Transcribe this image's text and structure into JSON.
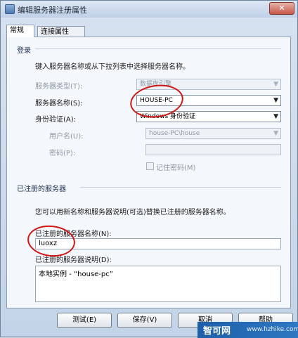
{
  "window": {
    "title": "编辑服务器注册属性",
    "close_glyph": "✕"
  },
  "tabs": [
    {
      "label": "常规",
      "active": true
    },
    {
      "label": "连接属性",
      "active": false
    }
  ],
  "login": {
    "group_title": "登录",
    "instruction": "键入服务器名称或从下拉列表中选择服务器名称。",
    "server_type_label": "服务器类型(T):",
    "server_type_value": "数据库引擎",
    "server_name_label": "服务器名称(S):",
    "server_name_value": "HOUSE-PC",
    "auth_label": "身份验证(A):",
    "auth_value": "Windows 身份验证",
    "username_label": "用户名(U):",
    "username_value": "house-PC\\house",
    "password_label": "密码(P):",
    "remember_label": "记住密码(M)"
  },
  "registered": {
    "group_title": "已注册的服务器",
    "instruction": "您可以用新名称和服务器说明(可选)替换已注册的服务器名称。",
    "name_label": "已注册的服务器名称(N):",
    "name_value": "luoxz",
    "desc_label": "已注册的服务器说明(D):",
    "desc_value": "本地实例 - “house-pc”"
  },
  "buttons": {
    "test": "测试(E)",
    "save": "保存(V)",
    "cancel": "取消",
    "help": "帮助"
  },
  "watermark": {
    "logo_text": "智可网",
    "url": "www.hzhike.com"
  },
  "colors": {
    "annotation_red": "#d01818",
    "title_bar": "#c4d4e8"
  }
}
